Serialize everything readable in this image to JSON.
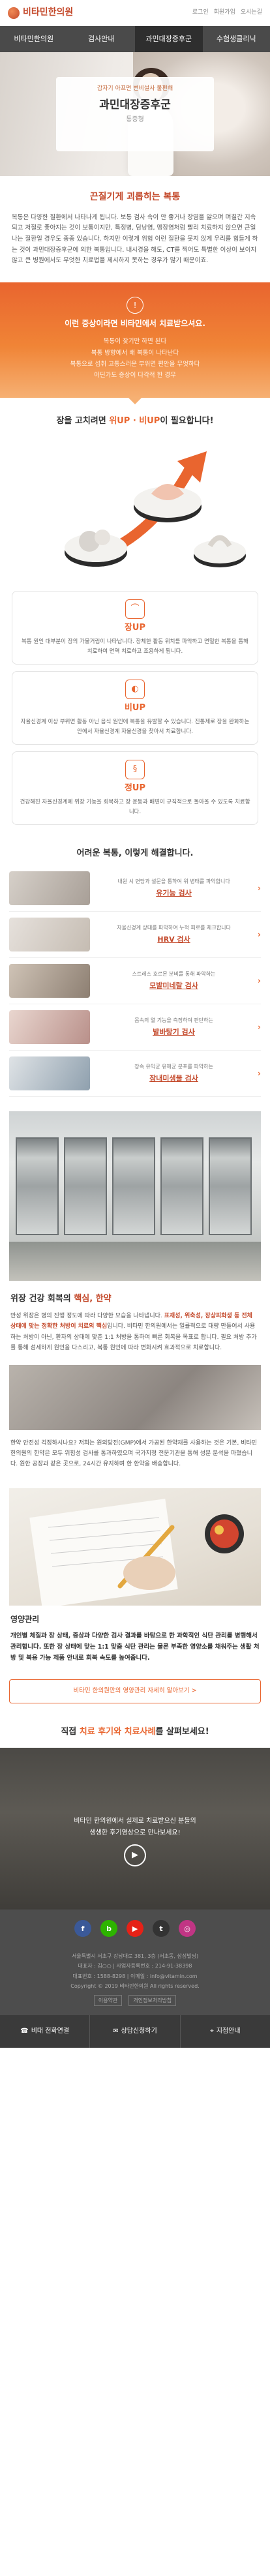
{
  "header": {
    "logo": "비타민한의원",
    "util": [
      "로그인",
      "회원가입",
      "오시는길"
    ]
  },
  "nav": [
    "비타민한의원",
    "검사안내",
    "과민대장증후군",
    "수험생클리닉"
  ],
  "hero": {
    "kicker": "갑자기 아프면 변비설사 불편해",
    "title": "과민대장증후군",
    "sub": "통증형"
  },
  "intro": {
    "title": "끈질기게 괴롭히는 복통",
    "body": "복통은 다양한 질환에서 나타나게 됩니다. 보통 검사 속이 안 좋거나 장염을 앓으며 며칠간 지속되고 저절로 좋아지는 것이 보통이지만, 특정병, 담낭염, 맹장염처럼 빨리 치료하지 않으면 큰일나는 질환일 경우도 종종 있습니다. 하지만 이렇게 위험 이런 질환을 못지 않게 우리를 힘들게 하는 것이 과민대장증후군에 의한 복통입니다. 내시경을 해도, CT를 찍어도 특별한 이상이 보이지 않고 큰 병원에서도 무엇한 치료법을 제시하지 못하는 경우가 많기 때문이죠."
  },
  "banner": {
    "icon": "!",
    "heading": "이런 증상이라면 비타민에서 치료받으셔요.",
    "lines": [
      "복통이 잦기만 하면 된다",
      "복통 방향에서 배 복통이 나타난다",
      "복통으로 섭취 고통스러운 부위면 편안을 무엇하다",
      "어딘가도 증상이 다각적 한 경우"
    ]
  },
  "increase": {
    "pre": "장을 고치려면 ",
    "hl": "위UP · 비UP",
    "post": "이 필요합니다!"
  },
  "features": [
    {
      "icon": "장UP",
      "title": "장UP",
      "desc": "복통 원인 대부분이 장의 가물거림이 나타납니다. 장체한 활동 위치를 파악하고 면밀한 복통을 통해 치료하여 면역 치료하고 조용하게 됩니다."
    },
    {
      "icon": "비UP",
      "title": "비UP",
      "desc": "자율신경계 이상 부위면 활동 아닌 음식 원인에 복통을 유발할 수 있습니다. 진통제로 장을 완화하는 안에서 자율신경계 자율신경을 찾아서 치료합니다."
    },
    {
      "icon": "정UP",
      "title": "정UP",
      "desc": "건강해진 자율신경계에 위장 기능을 회복하고 장 운동과 배변이 규칙적으로 돌아올 수 있도록 치료합니다."
    }
  ],
  "exams": {
    "title": "어려운 복통, 이렇게 해결합니다.",
    "items": [
      {
        "desc": "내원 시 면담과 설문을 통하여 위 병태를 파악합니다",
        "name": "유기능 검사"
      },
      {
        "desc": "자율신경계 상태를 파악하여 누적 피로를 체크합니다",
        "name": "HRV 검사"
      },
      {
        "desc": "스트레스 호르몬 분비를 통해 파악하는",
        "name": "모발미네랄 검사"
      },
      {
        "desc": "몸속의 열 기능을 측정하여 판단하는",
        "name": "발바탕기 검사"
      },
      {
        "desc": "장속 유익균 유해균 분포를 파악하는",
        "name": "장내미생물 검사"
      }
    ]
  },
  "gut": {
    "title_pre": "위장 건강 회복의 ",
    "title_hl": "핵심, 한약",
    "body_pre": "만성 위장은 병의 진행 정도에 따라 다양한 모습을 나타냅니다. ",
    "body_bold": "표재성, 위축성, 장상피화생 등 전체 상태에 맞는 정확한 처방이 치료의 핵심",
    "body_post": "입니다. 비타민 한의원에서는 일률적으로 대량 만들어서 사용하는 처방이 아닌, 환자의 상태에 맞춘 1:1 처방을 통하여 빠른 회복을 목표로 합니다. 필요 처방 추가를 통해 섬세하게 원인을 다스리고, 복통 원인에 따라 변화시켜 효과적으로 치료합니다."
  },
  "gut2": {
    "title": "한약 안전성 걱정하시나요?",
    "body": "한약 안전성 걱정하시나요? 저희는 원외탕전(GMP)에서 가공된 한약재를 사용하는 것은 기본, 비타민 한의원의 한약은 모두 위험성 검사를 통과하였으며 국가지정 전문기관을 통해 성분 분석을 마쳤습니다. 원한 공장과 같은 곳으로, 24시간 유지하며 한 한약을 배송합니다."
  },
  "nutrition": {
    "title": "영양관리",
    "body": "개인별 체질과 장 상태, 증상과 다양한 검사 결과를 바탕으로 한 과학적인 식단 관리를 병행해서 관리합니다. 또한 장 상태에 맞는 1:1 맞춤 식단 관리는 물론 부족한 영양소를 채워주는 생활 처방 및 복용 가능 제품 안내로 회복 속도를 높여줍니다."
  },
  "cta": "비타민 한의원만의 영양관리 자세히 알아보기 >",
  "consult": {
    "pre": "직접 ",
    "hl": "치료 후기와 치료사례",
    "post": "를 살펴보세요!"
  },
  "video": {
    "lines": [
      "비타민 한의원에서 실제로 치료받으신 분들의",
      "생생한 후기영상으로 만나보세요!"
    ],
    "play": "▶"
  },
  "social": [
    {
      "label": "f",
      "color": "#3b5998"
    },
    {
      "label": "b",
      "color": "#2db400"
    },
    {
      "label": "▶",
      "color": "#e62117"
    },
    {
      "label": "t",
      "color": "#333333"
    },
    {
      "label": "◎",
      "color": "#c13584"
    }
  ],
  "footer": {
    "lines": [
      "서울특별시 서초구 강남대로 381, 3층 (서초동, 삼성빌딩)",
      "대표자 : 김○○ | 사업자등록번호 : 214-91-38398",
      "대표번호 : 1588-8298 | 이메일 : info@vitamin.com",
      "Copyright © 2019 비타민한의원 All rights reserved."
    ],
    "links": [
      "이용약관",
      "개인정보처리방침"
    ]
  },
  "bottom": [
    "비대 전화연결",
    "상담신청하기",
    "지점안내"
  ]
}
